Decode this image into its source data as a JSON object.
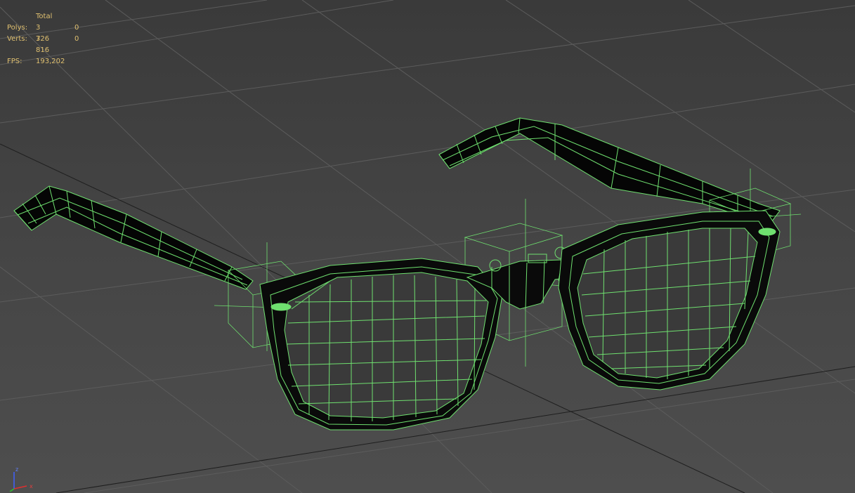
{
  "stats": {
    "header": "Total",
    "polys": {
      "label": "Polys:",
      "total": "3 726",
      "selected": "0"
    },
    "verts": {
      "label": "Verts:",
      "total": "3 816",
      "selected": "0"
    },
    "fps": {
      "label": "FPS:",
      "value": "193,202"
    }
  },
  "axis": {
    "z": "z",
    "x": "x"
  },
  "colors": {
    "wire": "#6fe06f",
    "stats_text": "#e0c070",
    "grid": "#5a5a5a",
    "axis_z": "#4060ff",
    "axis_x": "#e03030"
  }
}
